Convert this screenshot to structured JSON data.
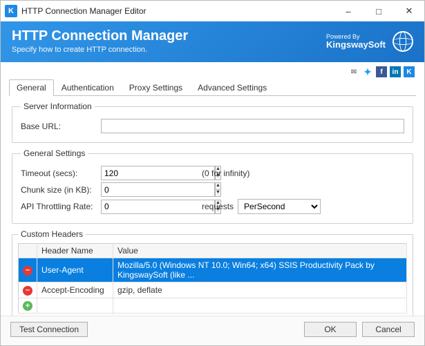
{
  "window": {
    "title": "HTTP Connection Manager Editor"
  },
  "header": {
    "title": "HTTP Connection Manager",
    "subtitle": "Specify how to create HTTP connection.",
    "powered_by_prefix": "Powered By",
    "brand": "KingswaySoft"
  },
  "tabs": [
    {
      "label": "General",
      "active": true
    },
    {
      "label": "Authentication",
      "active": false
    },
    {
      "label": "Proxy Settings",
      "active": false
    },
    {
      "label": "Advanced Settings",
      "active": false
    }
  ],
  "server": {
    "legend": "Server Information",
    "base_url_label": "Base URL:",
    "base_url_value": ""
  },
  "general": {
    "legend": "General Settings",
    "timeout_label": "Timeout (secs):",
    "timeout_value": "120",
    "timeout_hint": "(0 for infinity)",
    "chunk_label": "Chunk size (in KB):",
    "chunk_value": "0",
    "throttle_label": "API Throttling Rate:",
    "throttle_value": "0",
    "throttle_unit": "requests",
    "throttle_period": "PerSecond"
  },
  "headers": {
    "legend": "Custom Headers",
    "cols": {
      "name": "Header Name",
      "value": "Value"
    },
    "rows": [
      {
        "name": "User-Agent",
        "value": "Mozilla/5.0 (Windows NT 10.0; Win64; x64) SSIS Productivity Pack by KingswaySoft (like ...",
        "selected": true
      },
      {
        "name": "Accept-Encoding",
        "value": "gzip, deflate",
        "selected": false
      }
    ]
  },
  "footer": {
    "test": "Test Connection",
    "ok": "OK",
    "cancel": "Cancel"
  }
}
